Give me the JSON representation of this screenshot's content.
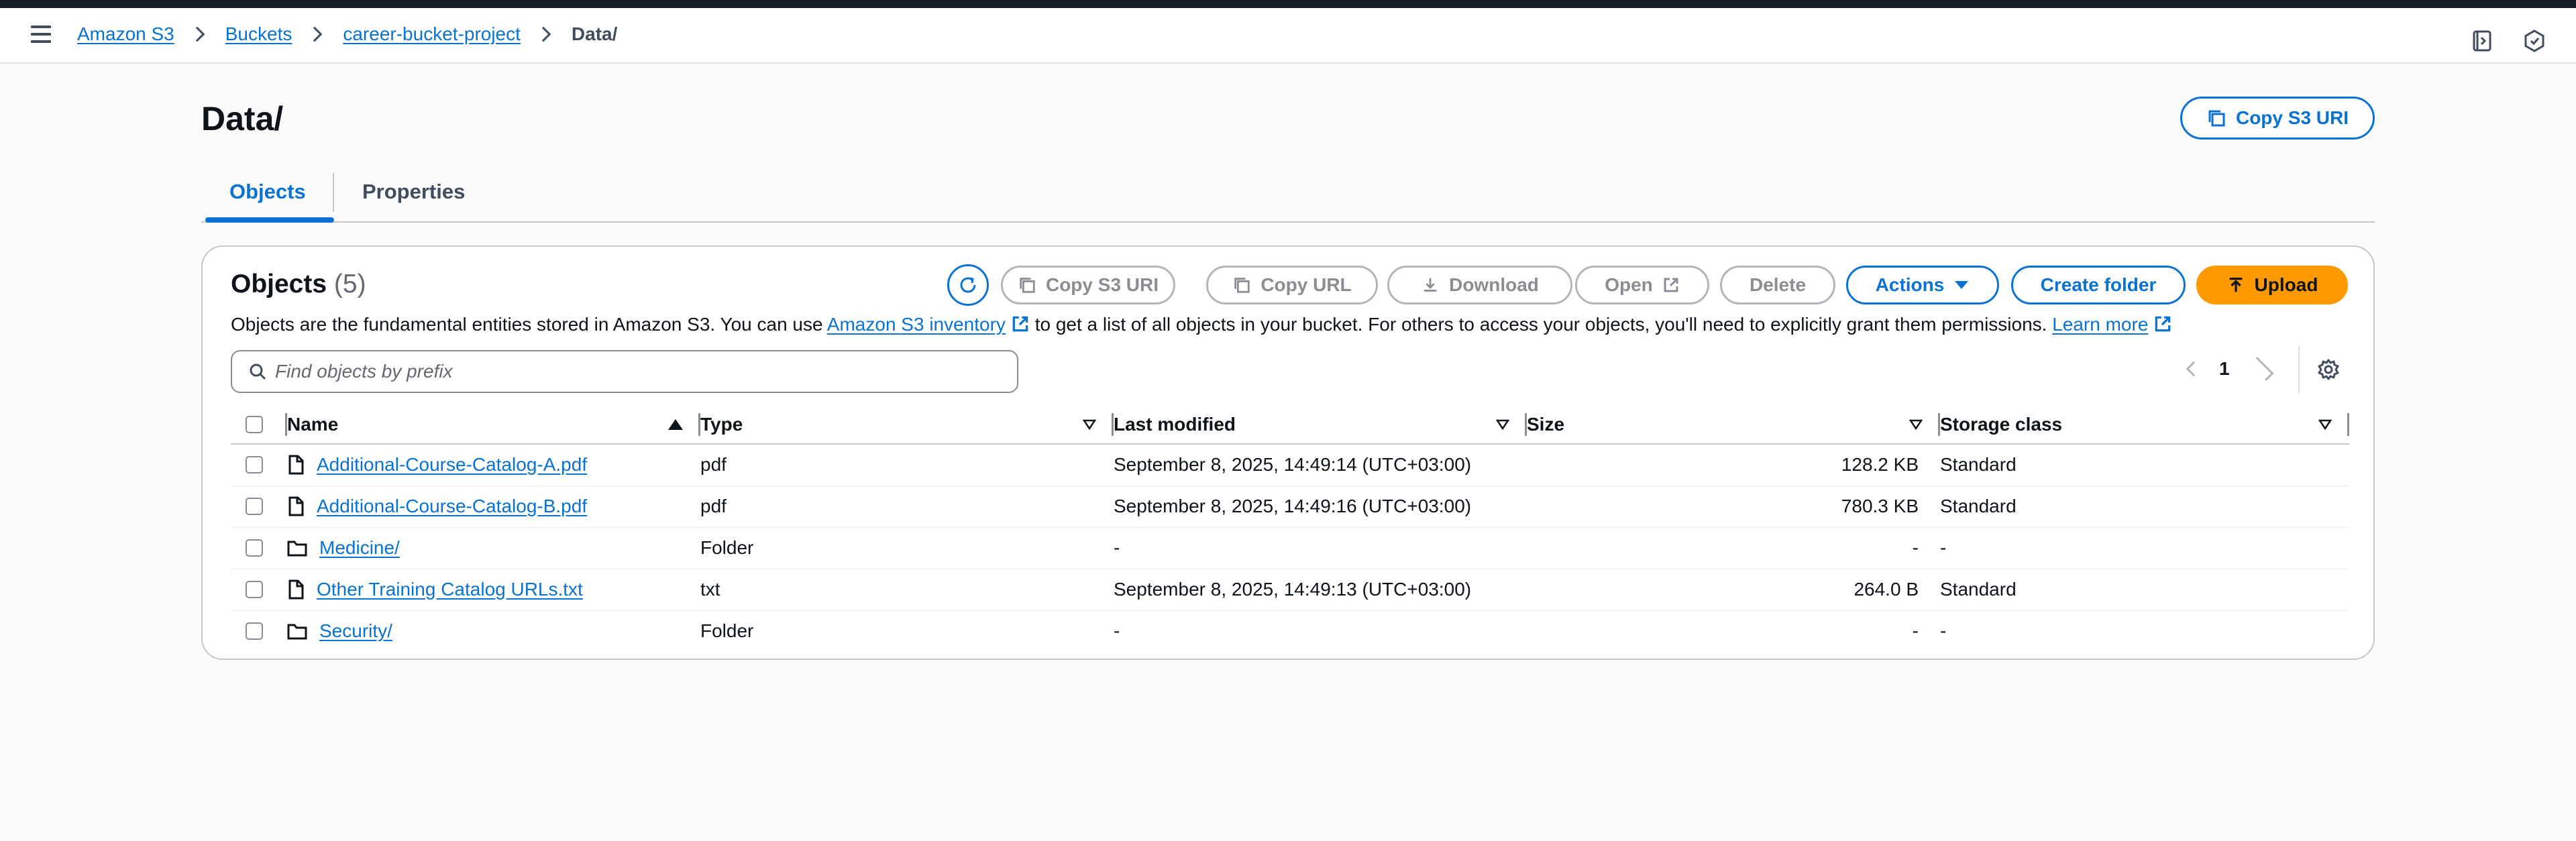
{
  "breadcrumb": {
    "items": [
      "Amazon S3",
      "Buckets",
      "career-bucket-project"
    ],
    "current": "Data/"
  },
  "page": {
    "title": "Data/",
    "copy_uri_label": "Copy S3 URI"
  },
  "tabs": [
    {
      "label": "Objects",
      "active": true
    },
    {
      "label": "Properties",
      "active": false
    }
  ],
  "objects_panel": {
    "title": "Objects",
    "count": "(5)",
    "toolbar": {
      "copy_s3_uri": "Copy S3 URI",
      "copy_url": "Copy URL",
      "download": "Download",
      "open": "Open",
      "delete": "Delete",
      "actions": "Actions",
      "create_folder": "Create folder",
      "upload": "Upload"
    },
    "description": {
      "before": "Objects are the fundamental entities stored in Amazon S3. You can use ",
      "link1": "Amazon S3 inventory",
      "middle": " to get a list of all objects in your bucket. For others to access your objects, you'll need to explicitly grant them permissions. ",
      "link2": "Learn more"
    },
    "search_placeholder": "Find objects by prefix",
    "page_number": "1",
    "columns": [
      "Name",
      "Type",
      "Last modified",
      "Size",
      "Storage class"
    ],
    "rows": [
      {
        "icon": "file-icon",
        "name": "Additional-Course-Catalog-A.pdf",
        "type": "pdf",
        "modified": "September 8, 2025, 14:49:14 (UTC+03:00)",
        "size": "128.2 KB",
        "storage": "Standard"
      },
      {
        "icon": "file-icon",
        "name": "Additional-Course-Catalog-B.pdf",
        "type": "pdf",
        "modified": "September 8, 2025, 14:49:16 (UTC+03:00)",
        "size": "780.3 KB",
        "storage": "Standard"
      },
      {
        "icon": "folder-icon",
        "name": "Medicine/",
        "type": "Folder",
        "modified": "-",
        "size": "-",
        "storage": "-"
      },
      {
        "icon": "file-icon",
        "name": "Other Training Catalog URLs.txt",
        "type": "txt",
        "modified": "September 8, 2025, 14:49:13 (UTC+03:00)",
        "size": "264.0 B",
        "storage": "Standard"
      },
      {
        "icon": "folder-icon",
        "name": "Security/",
        "type": "Folder",
        "modified": "-",
        "size": "-",
        "storage": "-"
      }
    ]
  },
  "colors": {
    "accent": "#0972d3",
    "upload": "#ff9900",
    "topbar": "#161d26"
  }
}
